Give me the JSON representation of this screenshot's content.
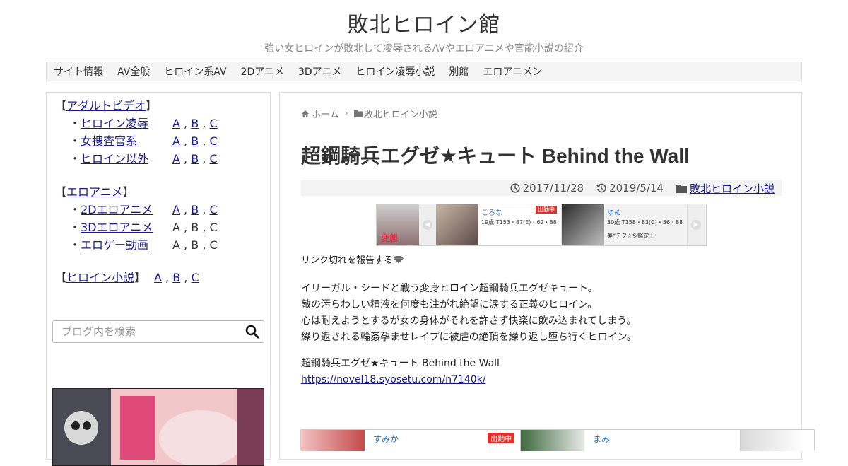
{
  "site": {
    "title": "敗北ヒロイン館",
    "description": "強い女ヒロインが敗北して凌辱されるAVやエロアニメや官能小説の紹介"
  },
  "nav": [
    {
      "label": "サイト情報"
    },
    {
      "label": "AV全般"
    },
    {
      "label": "ヒロイン系AV"
    },
    {
      "label": "2Dアニメ"
    },
    {
      "label": "3Dアニメ"
    },
    {
      "label": "ヒロイン凌辱小説"
    },
    {
      "label": "別館"
    },
    {
      "label": "エロアニメン"
    }
  ],
  "sidebar": {
    "groups": [
      {
        "bracket_open": "【",
        "title": "アダルトビデオ",
        "bracket_close": "】",
        "items": [
          {
            "bullet": "・",
            "label": "ヒロイン凌辱",
            "a": "A",
            "b": "B",
            "c": "C",
            "linked": true
          },
          {
            "bullet": "・",
            "label": "女捜査官系",
            "a": "A",
            "b": "B",
            "c": "C",
            "linked": true
          },
          {
            "bullet": "・",
            "label": "ヒロイン以外",
            "a": "A",
            "b": "B",
            "c": "C",
            "linked": true
          }
        ]
      },
      {
        "bracket_open": "【",
        "title": "エロアニメ",
        "bracket_close": "】",
        "items": [
          {
            "bullet": "・",
            "label": "2Dエロアニメ",
            "a": "A",
            "b": "B",
            "c": "C",
            "linked": true
          },
          {
            "bullet": "・",
            "label": "3Dエロアニメ",
            "a": "A",
            "b": "B",
            "c": "C",
            "linked": false
          },
          {
            "bullet": "・",
            "label": "エロゲー動画",
            "a": "A",
            "b": "B",
            "c": "C",
            "linked": false
          }
        ]
      },
      {
        "bracket_open": "【",
        "title": "ヒロイン小説",
        "bracket_close": "】",
        "a": "A",
        "b": "B",
        "c": "C"
      }
    ],
    "comma": ",",
    "search_placeholder": "ブログ内を検索"
  },
  "breadcrumb": {
    "home": "ホーム",
    "category": "敗北ヒロイン小説"
  },
  "post": {
    "title": "超鋼騎兵エグゼ★キュート Behind the Wall",
    "date_published": "2017/11/28",
    "date_updated": "2019/5/14",
    "category": "敗北ヒロイン小説",
    "report_link": "リンク切れを報告する",
    "body": [
      "イリーガル・シードと戦う変身ヒロイン超鋼騎兵エグゼキュート。",
      "敵の汚らわしい精液を何度も注がれ絶望に涙する正義のヒロイン。",
      "心は耐えようとするが女の身体がそれを許さず快楽に飲み込まれてしまう。",
      "繰り返される輪姦孕ませレイプに被虐の絶頂を繰り返し堕ち行くヒロイン。"
    ],
    "work_title": "超鋼騎兵エグゼ★キュート Behind the Wall",
    "work_url": "https://novel18.syosetu.com/n7140k/"
  },
  "ad_strip": {
    "small_label": "変態",
    "cards": [
      {
        "name": "ころな",
        "spec": "19歳 T153・87(E)・62・88",
        "badge": "出勤中",
        "sub": ""
      },
      {
        "name": "ゆめ",
        "spec": "30歳 T158・83(C)・56・88",
        "badge": "",
        "sub": "美*テク☆彡鑑定士"
      }
    ]
  },
  "bottom_ads": {
    "cards": [
      {
        "name": "すみか",
        "badge": "出勤中"
      },
      {
        "name": "まみ",
        "badge": ""
      }
    ]
  },
  "colors": {
    "link": "#1a1a8c",
    "badge": "#d9342b",
    "ad_name": "#2a6fb8"
  }
}
